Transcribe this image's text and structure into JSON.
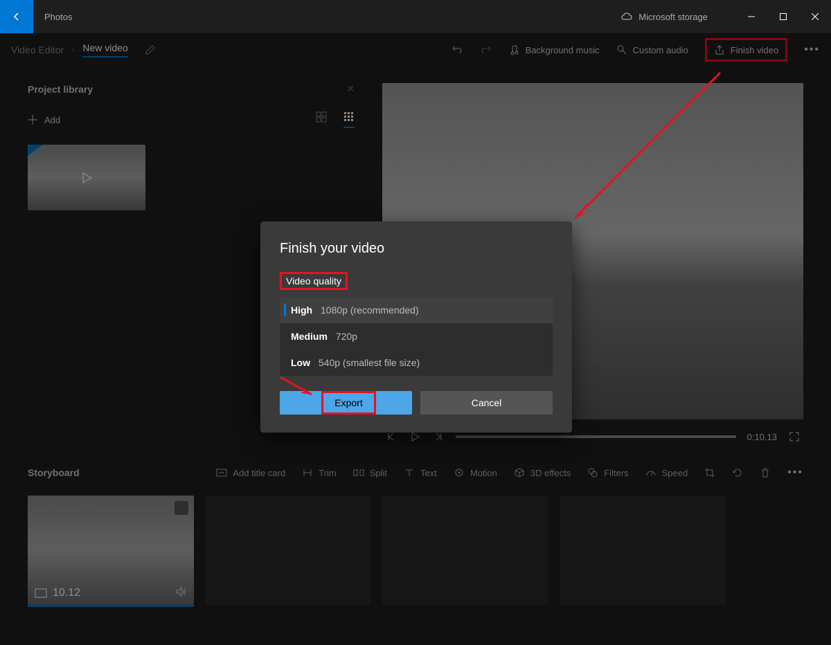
{
  "app": {
    "title": "Photos",
    "storage": "Microsoft storage"
  },
  "breadcrumb": {
    "root": "Video Editor",
    "current": "New video"
  },
  "toolbar": {
    "bg_music": "Background music",
    "custom_audio": "Custom audio",
    "finish_video": "Finish video"
  },
  "library": {
    "title": "Project library",
    "add": "Add"
  },
  "preview": {
    "time": "0:10.13"
  },
  "storyboard": {
    "title": "Storyboard",
    "add_title": "Add title card",
    "trim": "Trim",
    "split": "Split",
    "text": "Text",
    "motion": "Motion",
    "effects3d": "3D effects",
    "filters": "Filters",
    "speed": "Speed",
    "clip_duration": "10.12"
  },
  "dialog": {
    "title": "Finish your video",
    "quality_label": "Video quality",
    "options": [
      {
        "name": "High",
        "detail": "1080p (recommended)"
      },
      {
        "name": "Medium",
        "detail": "720p"
      },
      {
        "name": "Low",
        "detail": "540p (smallest file size)"
      }
    ],
    "export": "Export",
    "cancel": "Cancel"
  }
}
